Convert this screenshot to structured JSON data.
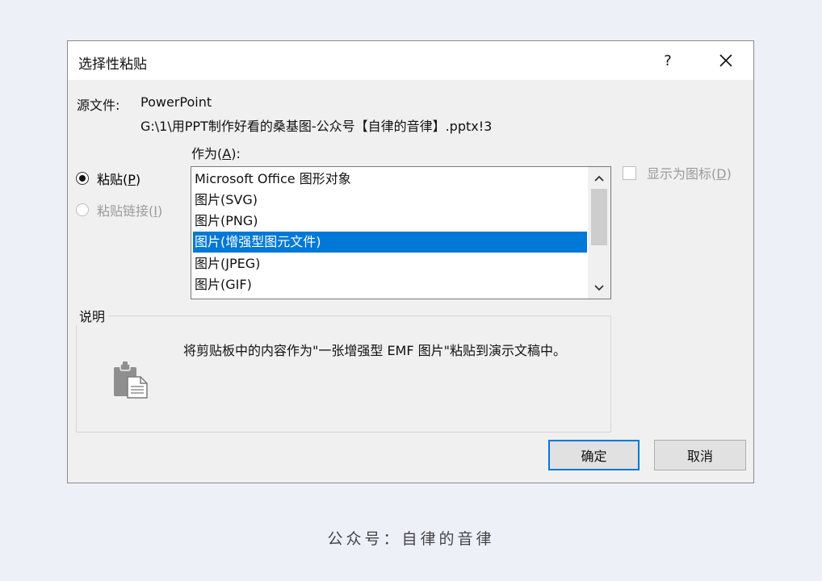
{
  "dialog": {
    "title": "选择性粘贴",
    "help": "?",
    "source_label": "源文件:",
    "source_app": "PowerPoint",
    "source_path": "G:\\1\\用PPT制作好看的桑基图-公众号【自律的音律】.pptx!3",
    "as_label_text": "作为(",
    "as_label_key": "A",
    "as_label_end": "):",
    "radio_paste": {
      "text": "粘贴(",
      "key": "P",
      "end": ")",
      "checked": true
    },
    "radio_link": {
      "text": "粘贴链接(",
      "key": "I",
      "end": ")",
      "checked": false,
      "disabled": true
    },
    "list_items": [
      "Microsoft Office 图形对象",
      "图片(SVG)",
      "图片(PNG)",
      "图片(增强型图元文件)",
      "图片(JPEG)",
      "图片(GIF)"
    ],
    "selected_index": 3,
    "checkbox_icon": {
      "text": "显示为图标(",
      "key": "D",
      "end": ")",
      "checked": false,
      "disabled": true
    },
    "group_label": "说明",
    "description": "将剪贴板中的内容作为\"一张增强型 EMF 图片\"粘贴到演示文稿中。",
    "ok_label": "确定",
    "cancel_label": "取消"
  },
  "caption": "公众号：自律的音律",
  "colors": {
    "accent": "#0078d7",
    "background": "#eef0f8"
  }
}
